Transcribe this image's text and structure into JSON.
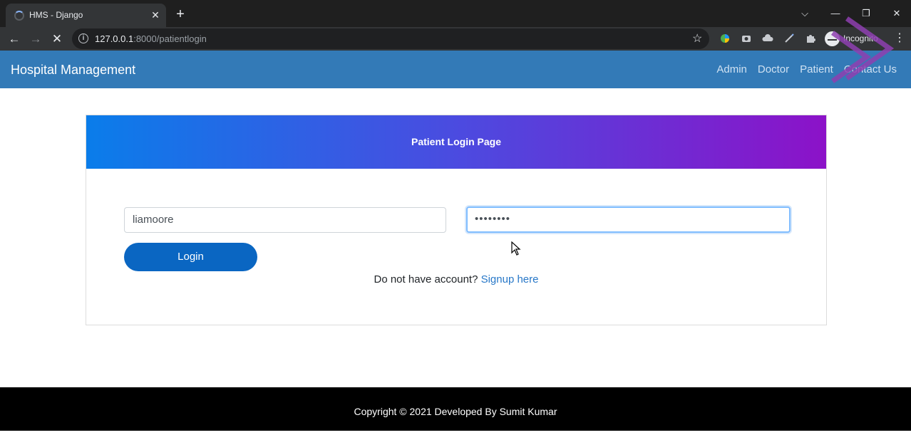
{
  "browser": {
    "tab_title": "HMS - Django",
    "tab_close": "✕",
    "new_tab": "+",
    "url_host": "127.0.0.1",
    "url_path": ":8000/patientlogin",
    "incognito_label": "Incognito",
    "window_controls": {
      "tab_search": "⌵",
      "minimize": "—",
      "restore": "❐",
      "close": "✕"
    },
    "nav": {
      "back": "←",
      "forward": "→",
      "stop": "✕"
    }
  },
  "navbar": {
    "brand": "Hospital Management",
    "links": [
      "Admin",
      "Doctor",
      "Patient",
      "Contact Us"
    ]
  },
  "login": {
    "header": "Patient Login Page",
    "username_value": "liamoore",
    "password_value": "••••••••",
    "login_label": "Login",
    "signup_prompt": "Do not have account? ",
    "signup_link": "Signup here"
  },
  "footer": {
    "text": "Copyright © 2021 Developed By Sumit Kumar"
  },
  "colors": {
    "navbar": "#337ab7",
    "header_gradient_start": "#0a7dea",
    "header_gradient_end": "#8c12c8",
    "login_button": "#0a66c2",
    "link": "#2878c8"
  }
}
